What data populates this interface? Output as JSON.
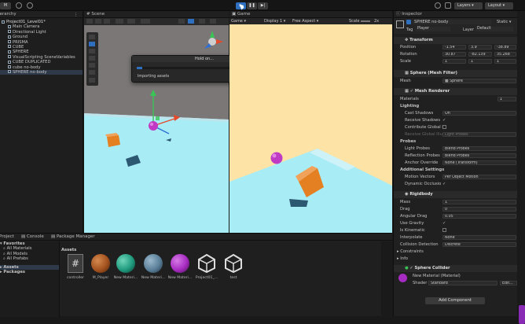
{
  "toolbar": {
    "account_label": "M",
    "layers_label": "Layers",
    "layout_label": "Layout",
    "play_icon": "play-icon",
    "pause_icon": "pause-icon",
    "step_icon": "step-icon"
  },
  "hierarchy": {
    "tab_label": "Hierarchy",
    "items": [
      "Project01_Level01*",
      "Main Camera",
      "Directional Light",
      "Ground",
      "PRISMA",
      "CUBE",
      "SPHERE",
      "VisualScripting SceneVariables",
      "CUBE DUPLICATED",
      "cube no-body",
      "SPHERE no-body"
    ],
    "selected_index": 10
  },
  "scene": {
    "tab_label": "Scene",
    "dialog": {
      "title": "Hold on...",
      "status": "Importing assets",
      "cancel_label": "Cancel"
    }
  },
  "game": {
    "tab_label": "Game",
    "mode": "Game",
    "display": "Display 1",
    "aspect": "Free Aspect",
    "scale_label": "Scale",
    "scale_value": "2x"
  },
  "inspector": {
    "tab_label": "Inspector",
    "object_name": "SPHERE no-body",
    "static_label": "Static",
    "tag_label": "Tag",
    "tag_value": "Player",
    "layer_label": "Layer",
    "layer_value": "Default",
    "transform": {
      "title": "Transform",
      "position_label": "Position",
      "position": [
        "-1.54",
        "3.9",
        "-38.89"
      ],
      "rotation_label": "Rotation",
      "rotation": [
        "30.87",
        "-82.139",
        "35.268"
      ],
      "scale_label": "Scale",
      "scale": [
        "1",
        "1",
        "1"
      ]
    },
    "mesh_filter": {
      "title": "Sphere (Mesh Filter)",
      "mesh_label": "Mesh",
      "mesh_value": "Sphere"
    },
    "mesh_renderer": {
      "title": "Mesh Renderer",
      "materials_label": "Materials",
      "materials_count": "1",
      "lighting_label": "Lighting",
      "cast_shadows_label": "Cast Shadows",
      "cast_shadows_value": "On",
      "receive_shadows_label": "Receive Shadows",
      "contribute_gi_label": "Contribute Global I",
      "receive_gi_label": "Receive Global Illu",
      "receive_gi_value": "Light Probes",
      "probes_label": "Probes",
      "light_probes_label": "Light Probes",
      "light_probes_value": "Blend Probes",
      "reflection_probes_label": "Reflection Probes",
      "reflection_probes_value": "Blend Probes",
      "anchor_override_label": "Anchor Override",
      "anchor_override_value": "None (Transform)",
      "additional_label": "Additional Settings",
      "motion_vectors_label": "Motion Vectors",
      "motion_vectors_value": "Per Object Motion",
      "dynamic_occlusion_label": "Dynamic Occlusio"
    },
    "rigidbody": {
      "title": "Rigidbody",
      "mass_label": "Mass",
      "mass_value": "1",
      "drag_label": "Drag",
      "drag_value": "0",
      "angular_drag_label": "Angular Drag",
      "angular_drag_value": "0.05",
      "use_gravity_label": "Use Gravity",
      "is_kinematic_label": "Is Kinematic",
      "interpolate_label": "Interpolate",
      "interpolate_value": "None",
      "collision_label": "Collision Detection",
      "collision_value": "Discrete",
      "constraints_label": "Constraints",
      "info_label": "Info"
    },
    "sphere_collider": {
      "title": "Sphere Collider"
    },
    "material": {
      "name": "New Material (Material)",
      "shader_label": "Shader",
      "shader_value": "Standard",
      "edit_label": "Edit..."
    },
    "add_component_label": "Add Component"
  },
  "project": {
    "tabs": [
      "Project",
      "Console",
      "Package Manager"
    ],
    "favorites_label": "Favorites",
    "favorites": [
      "All Materials",
      "All Models",
      "All Prefabs"
    ],
    "assets_label": "Assets",
    "packages_label": "Packages",
    "breadcrumb": "Assets",
    "assets": [
      {
        "name": "controller",
        "kind": "script",
        "color": "#3c3c3c"
      },
      {
        "name": "M_Player",
        "kind": "material",
        "color": "#a3521f"
      },
      {
        "name": "New Materi...",
        "kind": "material",
        "color": "#1f9a7d"
      },
      {
        "name": "New Materi...",
        "kind": "material",
        "color": "#5a7f98"
      },
      {
        "name": "New Materi...",
        "kind": "material",
        "color": "#a62bc0"
      },
      {
        "name": "Project01_...",
        "kind": "unity",
        "color": "#dddddd"
      },
      {
        "name": "test",
        "kind": "unity",
        "color": "#dddddd"
      }
    ]
  },
  "colors": {
    "accent": "#2e6fbf",
    "game_sky": "#fde4a6",
    "ground": "#a8ecf6",
    "sphere": "#c13ac4",
    "cube": "#e47f22"
  }
}
